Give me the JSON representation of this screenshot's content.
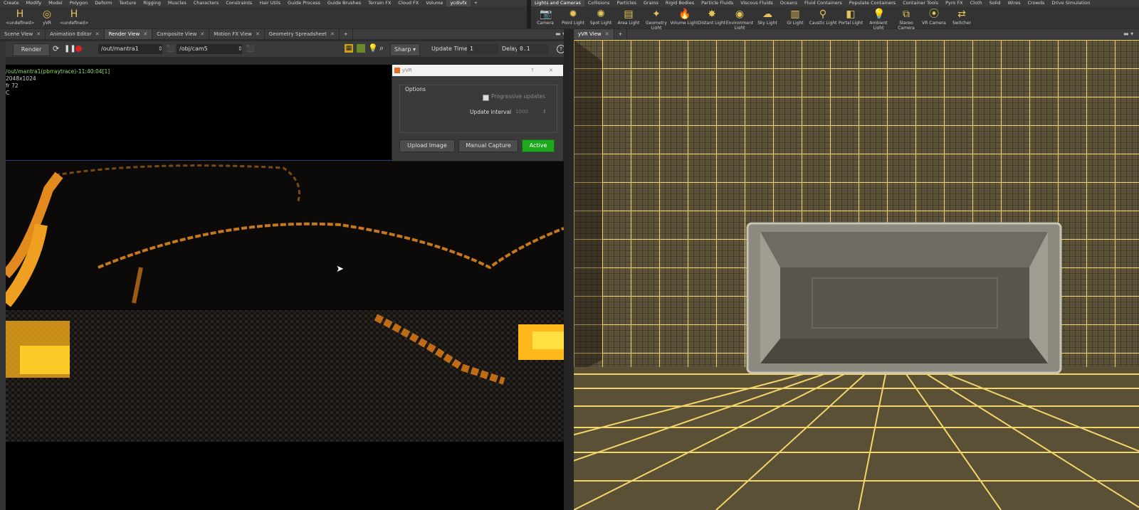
{
  "shelf_left": {
    "tabs": [
      "Create",
      "Modify",
      "Model",
      "Polygon",
      "Deform",
      "Texture",
      "Rigging",
      "Muscles",
      "Characters",
      "Constraints",
      "Hair Utils",
      "Guide Process",
      "Guide Brushes",
      "Terrain FX",
      "Cloud FX",
      "Volume",
      "ycdivfx"
    ],
    "active_tab": "ycdivfx",
    "add_label": "+",
    "tools": [
      {
        "label": "<undefined>",
        "icon": "houdini-icon"
      },
      {
        "label": "yVR",
        "icon": "yvr-icon"
      },
      {
        "label": "<undefined>",
        "icon": "houdini-icon"
      }
    ]
  },
  "shelf_right": {
    "tabs": [
      "Lights and Cameras",
      "Collisions",
      "Particles",
      "Grains",
      "Rigid Bodies",
      "Particle Fluids",
      "Viscous Fluids",
      "Oceans",
      "Fluid Containers",
      "Populate Containers",
      "Container Tools",
      "Pyro FX",
      "Cloth",
      "Solid",
      "Wires",
      "Crowds",
      "Drive Simulation"
    ],
    "active_tab": "Lights and Cameras",
    "tools": [
      {
        "label": "Camera",
        "icon": "camera-icon"
      },
      {
        "label": "Point Light",
        "icon": "point-light-icon"
      },
      {
        "label": "Spot Light",
        "icon": "spot-light-icon"
      },
      {
        "label": "Area Light",
        "icon": "area-light-icon"
      },
      {
        "label": "Geometry Light",
        "icon": "geometry-light-icon"
      },
      {
        "label": "Volume Light",
        "icon": "volume-light-icon"
      },
      {
        "label": "Distant Light",
        "icon": "distant-light-icon"
      },
      {
        "label": "Environment Light",
        "icon": "environment-light-icon"
      },
      {
        "label": "Sky Light",
        "icon": "sky-light-icon"
      },
      {
        "label": "GI Light",
        "icon": "gi-light-icon"
      },
      {
        "label": "Caustic Light",
        "icon": "caustic-light-icon"
      },
      {
        "label": "Portal Light",
        "icon": "portal-light-icon"
      },
      {
        "label": "Ambient Light",
        "icon": "ambient-light-icon"
      },
      {
        "label": "Stereo Camera",
        "icon": "stereo-camera-icon"
      },
      {
        "label": "VR Camera",
        "icon": "vr-camera-icon"
      },
      {
        "label": "Switcher",
        "icon": "switcher-icon"
      }
    ]
  },
  "left_pane": {
    "tabs": [
      "Scene View",
      "Animation Editor",
      "Render View",
      "Composite View",
      "Motion FX View",
      "Geometry Spreadsheet"
    ],
    "active_tab": "Render View",
    "toolbar": {
      "render_label": "Render",
      "output_path": "/out/mantra1",
      "camera_path": "/obj/cam5",
      "sharp_label": "Sharp",
      "update_time_label": "Update Time",
      "update_time_value": "1",
      "delay_label": "Delay",
      "delay_value": "0.1",
      "help_label": "?"
    },
    "render_info": {
      "title": "/out/mantra1(pbrraytrace)-11:40:04[1]",
      "resolution": "2048x1024",
      "frame": "fr 72",
      "channel": "C"
    }
  },
  "yvr_dialog": {
    "title": "yVR",
    "help": "?",
    "close": "✕",
    "group_label": "Options",
    "progressive_label": "Progressive updates",
    "interval_label": "Update interval",
    "interval_value": "1000",
    "upload_label": "Upload Image",
    "capture_label": "Manual Capture",
    "active_label": "Active",
    "active_color": "#1ea81e"
  },
  "right_pane": {
    "tab": "yVR View",
    "add_label": "+"
  }
}
